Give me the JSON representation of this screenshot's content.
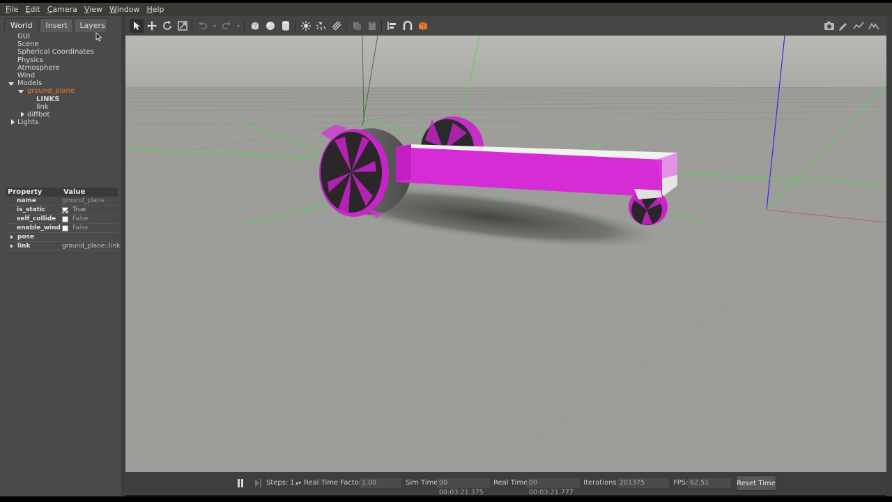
{
  "menubar": {
    "items": [
      {
        "label": "File",
        "u": "F",
        "rest": "ile"
      },
      {
        "label": "Edit",
        "u": "E",
        "rest": "dit"
      },
      {
        "label": "Camera",
        "u": "C",
        "rest": "amera"
      },
      {
        "label": "View",
        "u": "V",
        "rest": "iew"
      },
      {
        "label": "Window",
        "u": "W",
        "rest": "indow"
      },
      {
        "label": "Help",
        "u": "H",
        "rest": "elp"
      }
    ]
  },
  "tabs": [
    "World",
    "Insert",
    "Layers"
  ],
  "tree": {
    "gui": "GUI",
    "scene": "Scene",
    "spherical": "Spherical Coordinates",
    "physics": "Physics",
    "atmosphere": "Atmosphere",
    "wind": "Wind",
    "models": "Models",
    "ground_plane": "ground_plane",
    "links_header": "LINKS",
    "link": "link",
    "diffbot": "diffbot",
    "lights": "Lights"
  },
  "properties": {
    "header_property": "Property",
    "header_value": "Value",
    "name_key": "name",
    "name_value": "ground_plane",
    "is_static_key": "is_static",
    "is_static_value": "True",
    "self_collide_key": "self_collide",
    "self_collide_value": "False",
    "enable_wind_key": "enable_wind",
    "enable_wind_value": "False",
    "pose_key": "pose",
    "link_key": "link",
    "link_value": "ground_plane::link"
  },
  "bottombar": {
    "steps_label": "Steps:",
    "steps_value": "1",
    "rtf_label": "Real Time Factor:",
    "rtf_value": "1.00",
    "sim_label": "Sim Time:",
    "sim_value": "00 00:03:21.375",
    "real_label": "Real Time:",
    "real_value": "00 00:03:21.777",
    "iter_label": "Iterations:",
    "iter_value": "201375",
    "fps_label": "FPS:",
    "fps_value": "62.51",
    "reset_label": "Reset Time"
  },
  "colors": {
    "selected": "#e87a2c",
    "magenta": "#cc22cc",
    "axis_green": "#49e04a",
    "axis_blue": "#2a2af0",
    "axis_red": "#e04040"
  }
}
